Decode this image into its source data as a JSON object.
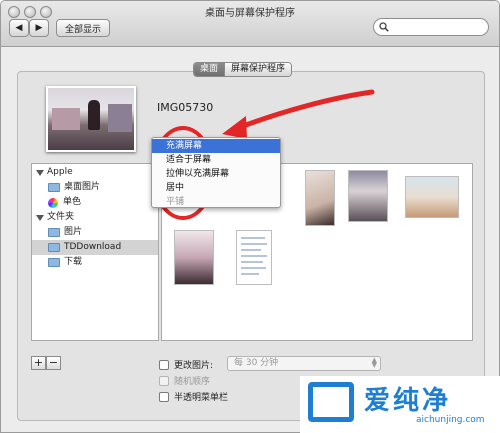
{
  "window": {
    "title": "桌面与屏幕保护程序",
    "show_all": "全部显示",
    "search": {
      "value": "",
      "placeholder": ""
    }
  },
  "tabs": [
    {
      "label": "桌面",
      "active": true
    },
    {
      "label": "屏幕保护程序",
      "active": false
    }
  ],
  "current_image": {
    "name": "IMG05730"
  },
  "fit_menu": {
    "items": [
      "充满屏幕",
      "适合于屏幕",
      "拉伸以充满屏幕",
      "居中",
      "平铺"
    ],
    "selected_index": 0,
    "disabled_index": 4
  },
  "sidebar": {
    "groups": [
      {
        "label": "Apple",
        "items": [
          {
            "label": "桌面图片",
            "icon": "folder-icon"
          },
          {
            "label": "单色",
            "icon": "color-wheel-icon"
          }
        ]
      },
      {
        "label": "文件夹",
        "items": [
          {
            "label": "图片",
            "icon": "folder-icon"
          },
          {
            "label": "TDDownload",
            "icon": "folder-icon",
            "selected": true
          },
          {
            "label": "下载",
            "icon": "folder-icon"
          }
        ]
      }
    ]
  },
  "options": {
    "change_picture": "更改图片:",
    "interval": "每 30 分钟",
    "random_order": "随机顺序",
    "translucent_menubar": "半透明菜单栏"
  },
  "controls": {
    "add": "+",
    "remove": "−"
  },
  "watermark": {
    "brand": "爱纯净",
    "url": "aichunjing.com"
  },
  "colors": {
    "selection": "#3a72d8",
    "annotation": "#e32626",
    "watermark": "#1e7fd2"
  }
}
